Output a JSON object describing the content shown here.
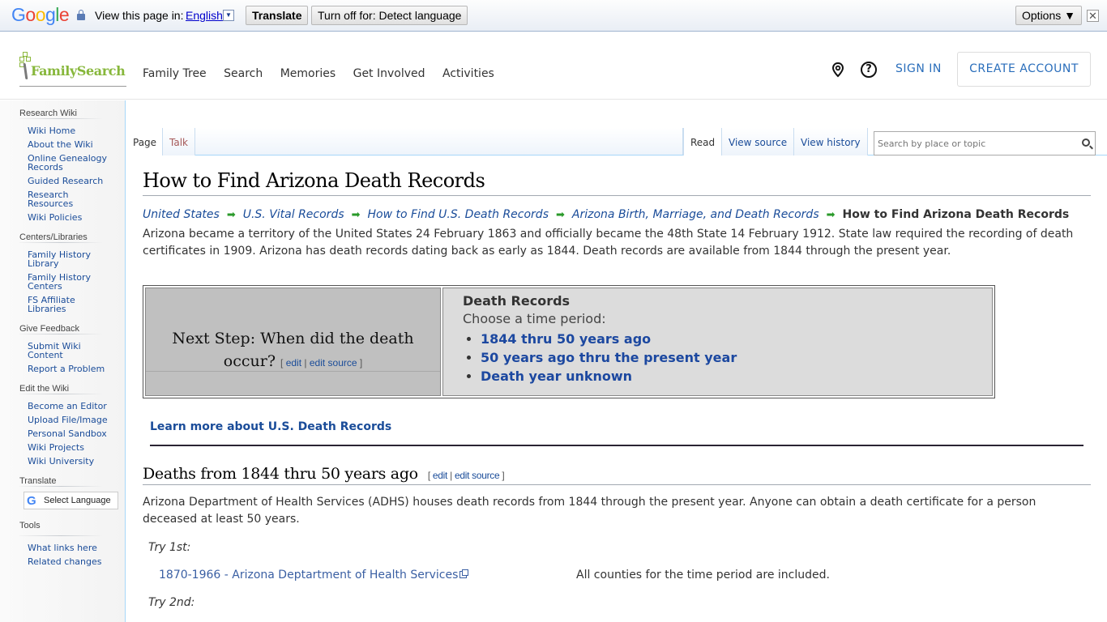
{
  "translate_bar": {
    "brand": [
      "G",
      "o",
      "o",
      "g",
      "l",
      "e"
    ],
    "view_label": "View this page in:",
    "language": "English",
    "translate_button": "Translate",
    "turn_off_button": "Turn off for: Detect language",
    "options_button": "Options ▼",
    "close": "✕"
  },
  "header": {
    "logo_text": "FamilySearch",
    "nav": [
      "Family Tree",
      "Search",
      "Memories",
      "Get Involved",
      "Activities"
    ],
    "help_glyph": "?",
    "sign_in": "SIGN IN",
    "create_account": "CREATE ACCOUNT"
  },
  "sidebar": {
    "sections": [
      {
        "title": "Research Wiki",
        "items": [
          "Wiki Home",
          "About the Wiki",
          "Online Genealogy Records",
          "Guided Research",
          "Research Resources",
          "Wiki Policies"
        ]
      },
      {
        "title": "Centers/Libraries",
        "items": [
          "Family History Library",
          "Family History Centers",
          "FS Affiliate Libraries"
        ]
      },
      {
        "title": "Give Feedback",
        "items": [
          "Submit Wiki Content",
          "Report a Problem"
        ]
      },
      {
        "title": "Edit the Wiki",
        "items": [
          "Become an Editor",
          "Upload File/Image",
          "Personal Sandbox",
          "Wiki Projects",
          "Wiki University"
        ]
      },
      {
        "title": "Translate",
        "select_language": "Select Language"
      },
      {
        "title": "Tools",
        "items": [
          "What links here",
          "Related changes"
        ]
      }
    ]
  },
  "tabs": {
    "page": "Page",
    "talk": "Talk",
    "read": "Read",
    "view_source": "View source",
    "view_history": "View history"
  },
  "search": {
    "placeholder": "Search by place or topic"
  },
  "article": {
    "title": "How to Find Arizona Death Records",
    "breadcrumbs": [
      "United States",
      "U.S. Vital Records",
      "How to Find U.S. Death Records",
      "Arizona Birth, Marriage, and Death Records"
    ],
    "breadcrumb_current": "How to Find Arizona Death Records",
    "breadcrumb_arrow": "➡",
    "intro": "Arizona became a territory of the United States 24 February 1863 and officially became the 48th State 14 February 1912. State law required the recording of death certificates in 1909. Arizona has death records dating back as early as 1844. Death records are available from 1844 through the present year.",
    "next_step": {
      "question": "Next Step: When did the death occur?",
      "edit": "edit",
      "edit_source": "edit source",
      "box_title": "Death Records",
      "box_subtitle": "Choose a time period:",
      "options": [
        "1844 thru 50 years ago",
        "50 years ago thru the present year",
        "Death year unknown"
      ]
    },
    "learn_more": "Learn more about U.S. Death Records",
    "section": {
      "heading": "Deaths from 1844 thru 50 years ago",
      "edit": "edit",
      "edit_source": "edit source",
      "body": "Arizona Department of Health Services (ADHS) houses death records from 1844 through the present year. Anyone can obtain a death certificate for a person deceased at least 50 years.",
      "try1": "Try 1st:",
      "record_link": "1870-1966 - Arizona Deptartment of Health Services",
      "record_note": "All counties for the time period are included.",
      "try2": "Try 2nd:"
    }
  }
}
